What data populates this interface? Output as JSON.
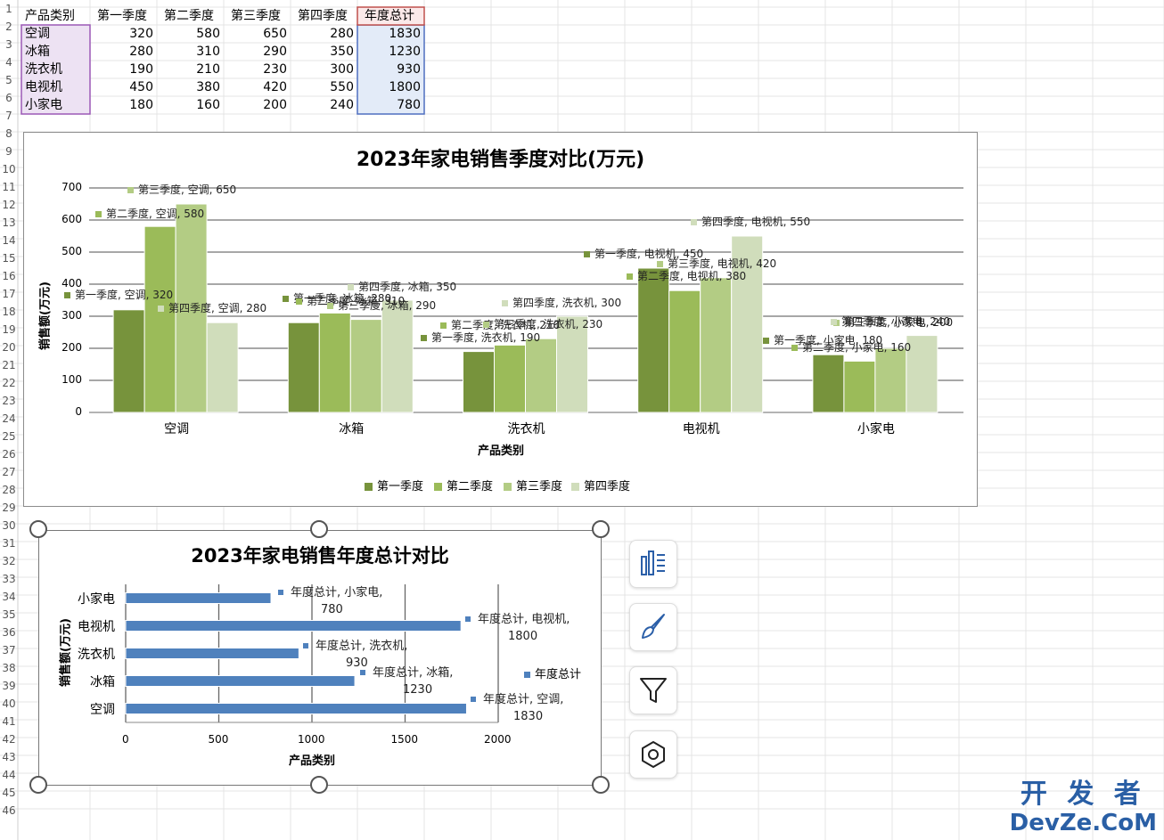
{
  "sheet": {
    "headers": [
      "产品类别",
      "第一季度",
      "第二季度",
      "第三季度",
      "第四季度",
      "年度总计"
    ],
    "rows": [
      [
        "空调",
        "320",
        "580",
        "650",
        "280",
        "1830"
      ],
      [
        "冰箱",
        "280",
        "310",
        "290",
        "350",
        "1230"
      ],
      [
        "洗衣机",
        "190",
        "210",
        "230",
        "300",
        "930"
      ],
      [
        "电视机",
        "450",
        "380",
        "420",
        "550",
        "1800"
      ],
      [
        "小家电",
        "180",
        "160",
        "200",
        "240",
        "780"
      ]
    ],
    "row_numbers": [
      "1",
      "2",
      "3",
      "4",
      "5",
      "6",
      "7",
      "8",
      "9",
      "10",
      "11",
      "12",
      "13",
      "14",
      "15",
      "16",
      "17",
      "18",
      "19",
      "20",
      "21",
      "22",
      "23",
      "24",
      "25",
      "26",
      "27",
      "28",
      "29",
      "30",
      "31",
      "32",
      "33",
      "34",
      "35",
      "36",
      "37",
      "38",
      "39",
      "40",
      "41",
      "42",
      "43",
      "44",
      "45",
      "46"
    ]
  },
  "chart_data": [
    {
      "type": "bar",
      "title": "2023年家电销售季度对比(万元)",
      "xlabel": "产品类别",
      "ylabel": "销售额(万元)",
      "categories": [
        "空调",
        "冰箱",
        "洗衣机",
        "电视机",
        "小家电"
      ],
      "series": [
        {
          "name": "第一季度",
          "values": [
            320,
            280,
            190,
            450,
            180
          ],
          "color": "#77933c"
        },
        {
          "name": "第二季度",
          "values": [
            580,
            310,
            210,
            380,
            160
          ],
          "color": "#9bbb59"
        },
        {
          "name": "第三季度",
          "values": [
            650,
            290,
            230,
            420,
            200
          ],
          "color": "#b3cc84"
        },
        {
          "name": "第四季度",
          "values": [
            280,
            350,
            300,
            550,
            240
          ],
          "color": "#d0ddbb"
        }
      ],
      "ylim": [
        0,
        700
      ],
      "yticks": [
        "0",
        "100",
        "200",
        "300",
        "400",
        "500",
        "600",
        "700"
      ],
      "grid": true,
      "legend": "bottom",
      "data_labels": [
        [
          "第一季度, 空调, 320",
          "第二季度, 空调, 580",
          "第三季度, 空调, 650",
          "第四季度, 空调, 280"
        ],
        [
          "第一季度, 冰箱, 280",
          "第二季度, 冰箱, 310",
          "第三季度, 冰箱, 290",
          "第四季度, 冰箱, 350"
        ],
        [
          "第一季度, 洗衣机, 190",
          "第二季度, 洗衣机, 210",
          "第三季度, 洗衣机, 230",
          "第四季度, 洗衣机, 300"
        ],
        [
          "第一季度, 电视机, 450",
          "第二季度, 电视机, 380",
          "第三季度, 电视机, 420",
          "第四季度, 电视机, 550"
        ],
        [
          "第一季度, 小家电, 180",
          "第二季度, 小家电, 160",
          "第三季度, 小家电, 200",
          "第四季度, 小家电, 240"
        ]
      ]
    },
    {
      "type": "bar",
      "orientation": "horizontal",
      "title": "2023年家电销售年度总计对比",
      "xlabel": "产品类别",
      "ylabel": "销售额(万元)",
      "categories": [
        "小家电",
        "电视机",
        "洗衣机",
        "冰箱",
        "空调"
      ],
      "series": [
        {
          "name": "年度总计",
          "values": [
            780,
            1800,
            930,
            1230,
            1830
          ],
          "color": "#4f81bd"
        }
      ],
      "xlim": [
        0,
        2000
      ],
      "xticks": [
        "0",
        "500",
        "1000",
        "1500",
        "2000"
      ],
      "grid": true,
      "legend": "right",
      "data_labels": [
        [
          "年度总计, 小家电,",
          "780"
        ],
        [
          "年度总计, 电视机,",
          "1800"
        ],
        [
          "年度总计, 洗衣机,",
          "930"
        ],
        [
          "年度总计, 冰箱,",
          "1230"
        ],
        [
          "年度总计, 空调,",
          "1830"
        ]
      ]
    }
  ],
  "toolbar": {
    "icons": [
      "chart-elements-icon",
      "chart-styles-icon",
      "chart-filter-icon",
      "chart-settings-icon"
    ]
  },
  "watermark": {
    "line1": "开 发 者",
    "line2": "DevZe.CoM"
  }
}
